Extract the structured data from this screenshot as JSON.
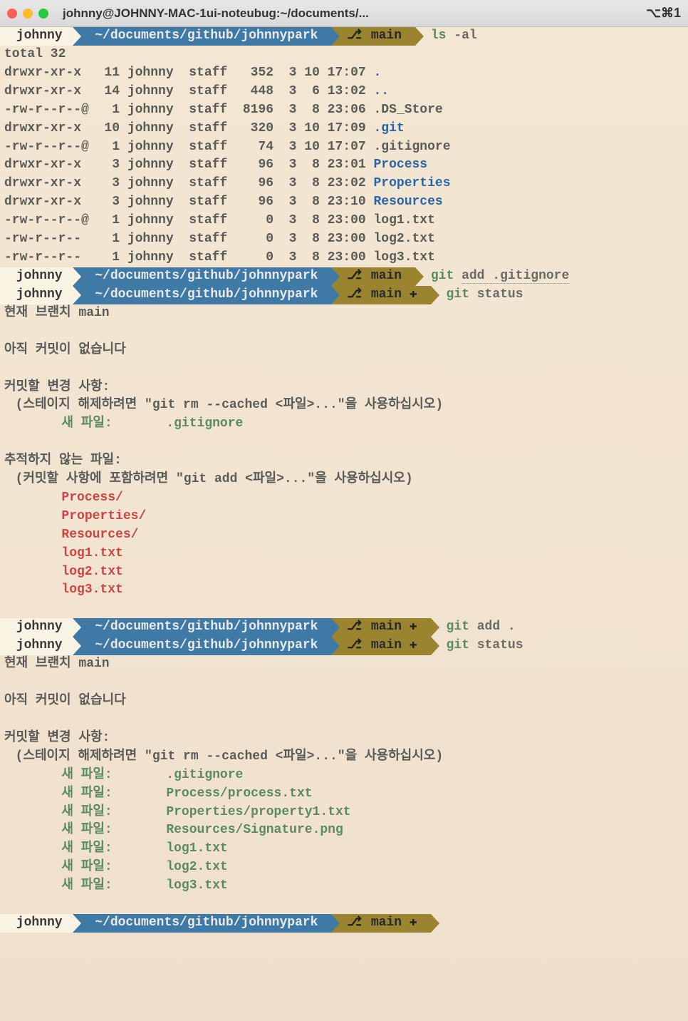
{
  "window": {
    "title": "johnny@JOHNNY-MAC-1ui-noteubug:~/documents/...",
    "shortcut": "⌥⌘1"
  },
  "prompt": {
    "user": "johnny",
    "path": "~/documents/github/johnnypark",
    "branch": "main",
    "plus": "✚",
    "branch_icon": "⎇"
  },
  "cmds": {
    "ls": "ls",
    "ls_arg": "-al",
    "git_add_ignore": "git",
    "git_add_ignore_arg": "add .gitignore",
    "git_status": "git",
    "git_status_arg": "status",
    "git_add_dot": "git",
    "git_add_dot_arg": "add .",
    "git_status2": "git",
    "git_status2_arg": "status"
  },
  "ls": {
    "total": "total 32",
    "rows": [
      {
        "perm": "drwxr-xr-x",
        "n": "11",
        "u": "johnny",
        "g": "staff",
        "sz": "352",
        "d": "3 10 17:07",
        "name": ".",
        "cls": "blue"
      },
      {
        "perm": "drwxr-xr-x",
        "n": "14",
        "u": "johnny",
        "g": "staff",
        "sz": "448",
        "d": "3  6 13:02",
        "name": "..",
        "cls": "blue"
      },
      {
        "perm": "-rw-r--r--@",
        "n": "1",
        "u": "johnny",
        "g": "staff",
        "sz": "8196",
        "d": "3  8 23:06",
        "name": ".DS_Store",
        "cls": ""
      },
      {
        "perm": "drwxr-xr-x",
        "n": "10",
        "u": "johnny",
        "g": "staff",
        "sz": "320",
        "d": "3 10 17:09",
        "name": ".git",
        "cls": "blue"
      },
      {
        "perm": "-rw-r--r--@",
        "n": "1",
        "u": "johnny",
        "g": "staff",
        "sz": "74",
        "d": "3 10 17:07",
        "name": ".gitignore",
        "cls": ""
      },
      {
        "perm": "drwxr-xr-x",
        "n": "3",
        "u": "johnny",
        "g": "staff",
        "sz": "96",
        "d": "3  8 23:01",
        "name": "Process",
        "cls": "blue"
      },
      {
        "perm": "drwxr-xr-x",
        "n": "3",
        "u": "johnny",
        "g": "staff",
        "sz": "96",
        "d": "3  8 23:02",
        "name": "Properties",
        "cls": "blue"
      },
      {
        "perm": "drwxr-xr-x",
        "n": "3",
        "u": "johnny",
        "g": "staff",
        "sz": "96",
        "d": "3  8 23:10",
        "name": "Resources",
        "cls": "blue"
      },
      {
        "perm": "-rw-r--r--@",
        "n": "1",
        "u": "johnny",
        "g": "staff",
        "sz": "0",
        "d": "3  8 23:00",
        "name": "log1.txt",
        "cls": ""
      },
      {
        "perm": "-rw-r--r--",
        "n": "1",
        "u": "johnny",
        "g": "staff",
        "sz": "0",
        "d": "3  8 23:00",
        "name": "log2.txt",
        "cls": ""
      },
      {
        "perm": "-rw-r--r--",
        "n": "1",
        "u": "johnny",
        "g": "staff",
        "sz": "0",
        "d": "3  8 23:00",
        "name": "log3.txt",
        "cls": ""
      }
    ]
  },
  "status1": {
    "branch_line": "현재 브랜치 main",
    "no_commit": "아직 커밋이 없습니다",
    "changes_header": "커밋할 변경 사항:",
    "unstage_hint": "  (스테이지 해제하려면 \"git rm --cached <파일>...\"을 사용하십시오)",
    "new_file_label": "새 파일:",
    "new_files": [
      ".gitignore"
    ],
    "untracked_header": "추적하지 않는 파일:",
    "untracked_hint": "  (커밋할 사항에 포함하려면 \"git add <파일>...\"을 사용하십시오)",
    "untracked": [
      "Process/",
      "Properties/",
      "Resources/",
      "log1.txt",
      "log2.txt",
      "log3.txt"
    ]
  },
  "status2": {
    "branch_line": "현재 브랜치 main",
    "no_commit": "아직 커밋이 없습니다",
    "changes_header": "커밋할 변경 사항:",
    "unstage_hint": "  (스테이지 해제하려면 \"git rm --cached <파일>...\"을 사용하십시오)",
    "new_file_label": "새 파일:",
    "new_files": [
      ".gitignore",
      "Process/process.txt",
      "Properties/property1.txt",
      "Resources/Signature.png",
      "log1.txt",
      "log2.txt",
      "log3.txt"
    ]
  }
}
